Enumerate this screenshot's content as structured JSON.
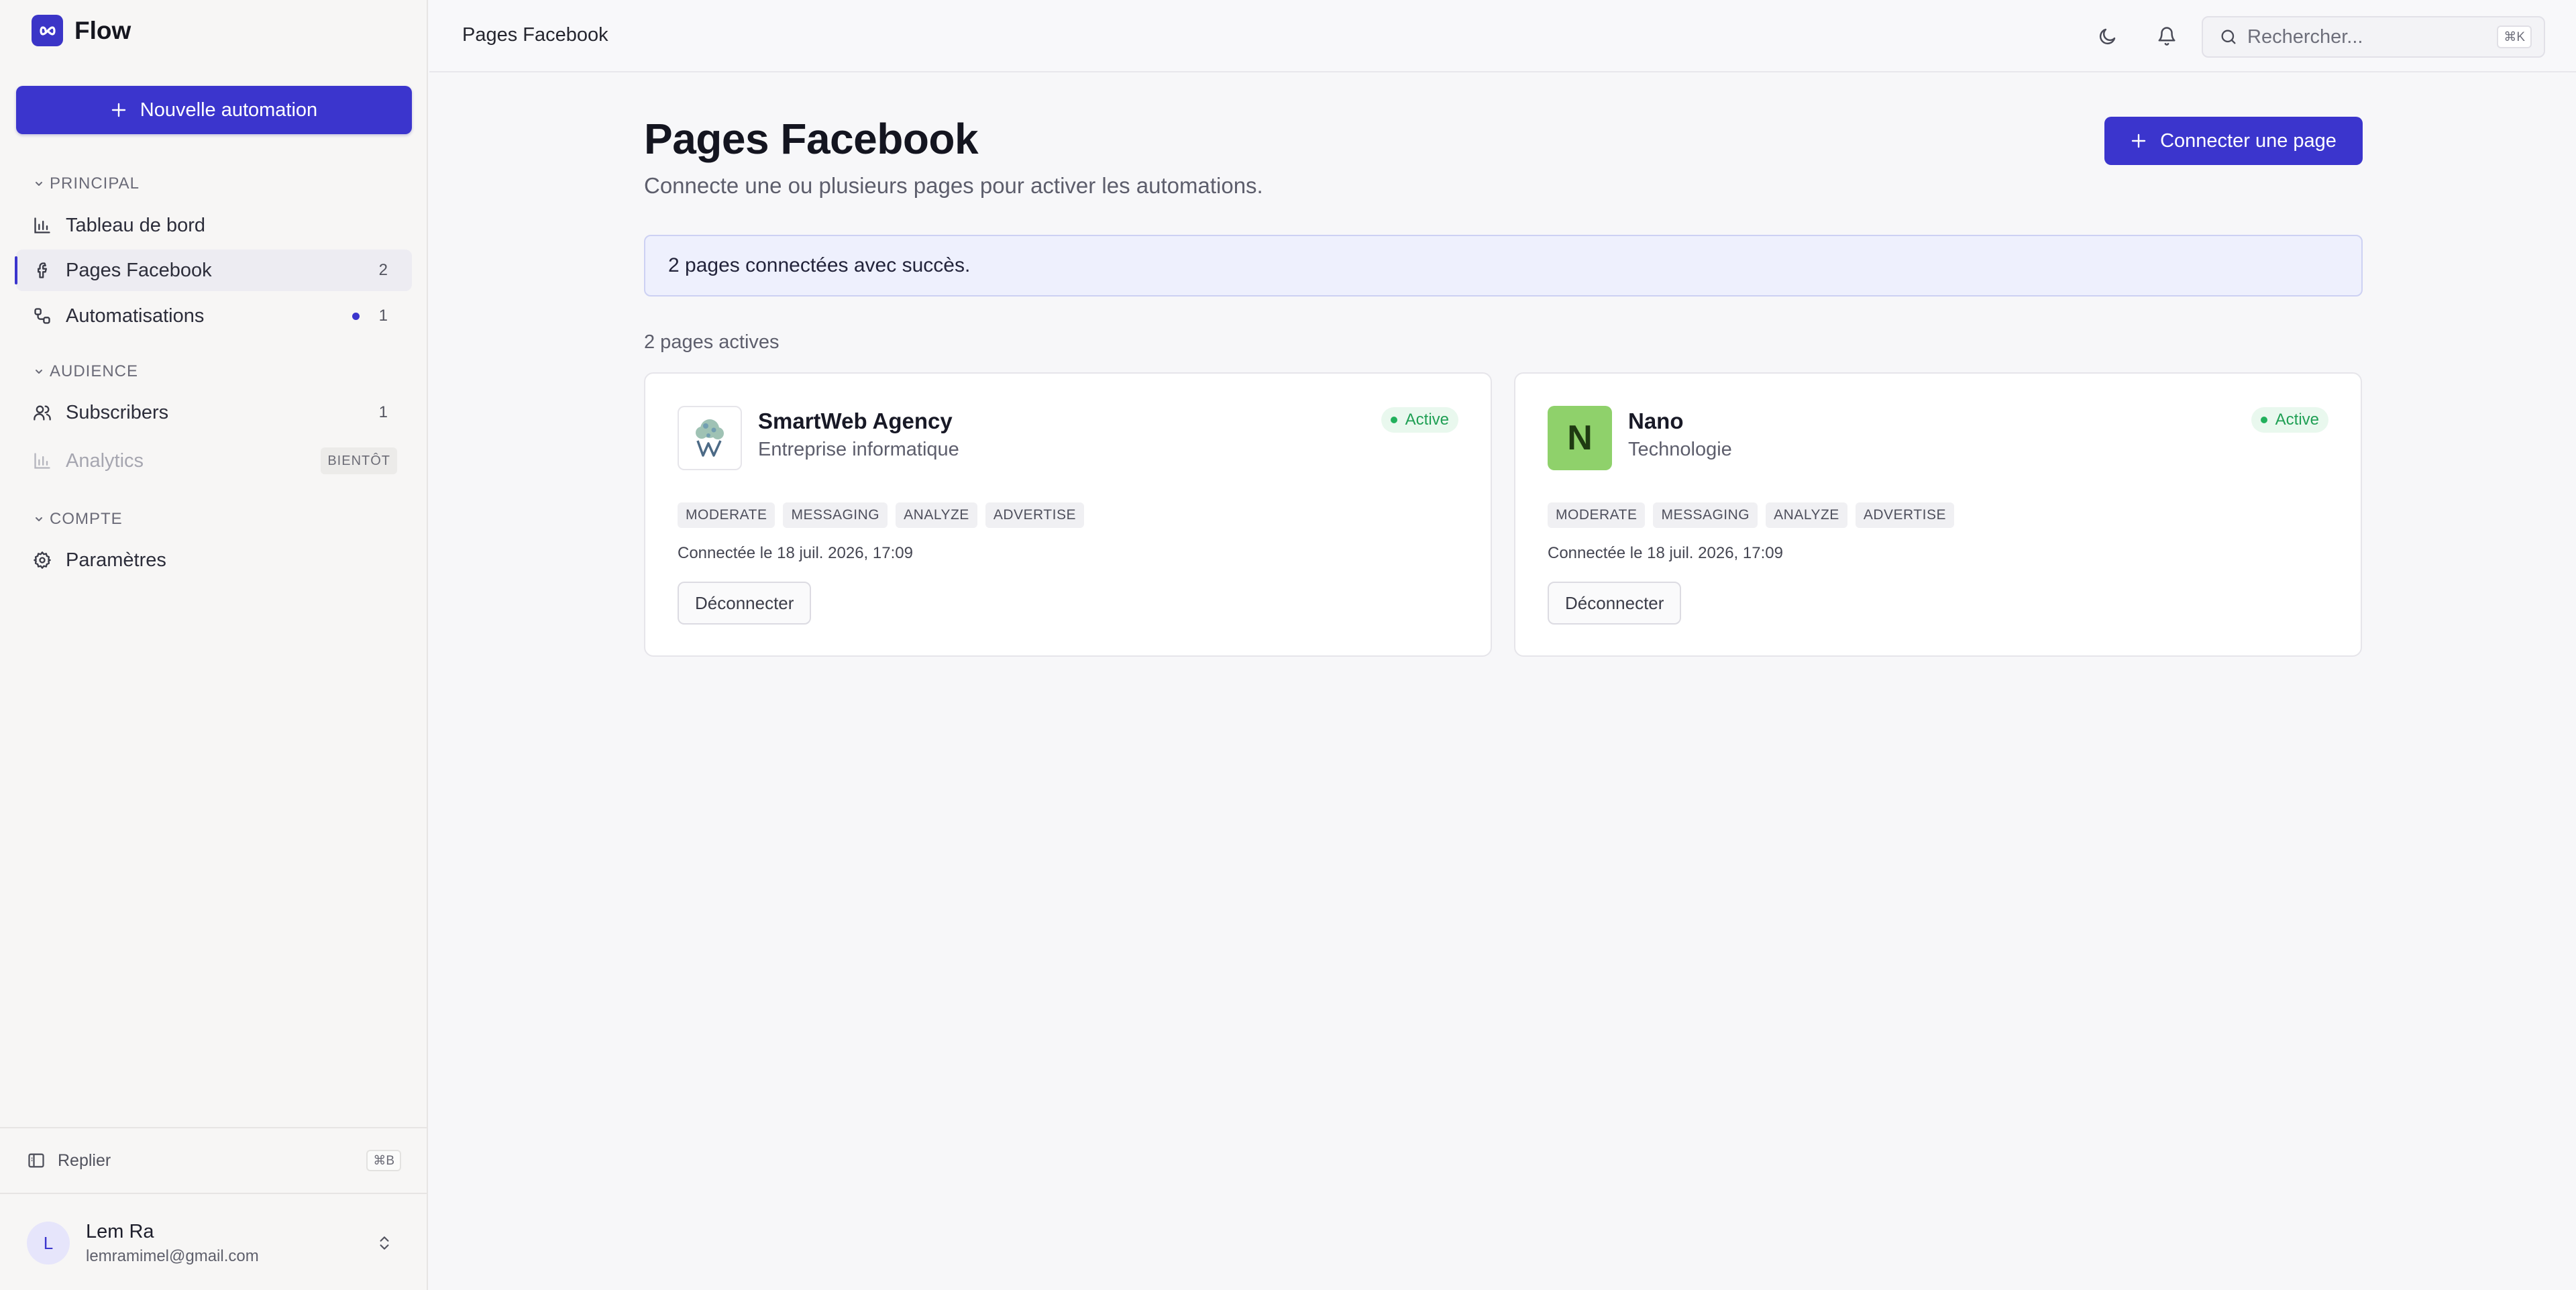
{
  "app": {
    "name": "Flow"
  },
  "sidebar": {
    "new_automation_label": "Nouvelle automation",
    "sections": {
      "principal": "PRINCIPAL",
      "audience": "AUDIENCE",
      "compte": "COMPTE"
    },
    "items": [
      {
        "label": "Tableau de bord",
        "icon": "bar-chart-icon"
      },
      {
        "label": "Pages Facebook",
        "icon": "facebook-icon",
        "count": "2",
        "active": true
      },
      {
        "label": "Automatisations",
        "icon": "workflow-icon",
        "count": "1",
        "has_dot": true
      },
      {
        "label": "Subscribers",
        "icon": "users-icon",
        "count": "1"
      },
      {
        "label": "Analytics",
        "icon": "bar-chart-icon",
        "badge": "BIENTÔT",
        "disabled": true
      },
      {
        "label": "Paramètres",
        "icon": "gear-icon"
      }
    ],
    "collapse": {
      "label": "Replier",
      "shortcut": "⌘B"
    },
    "user": {
      "initial": "L",
      "name": "Lem Ra",
      "email": "lemramimel@gmail.com"
    }
  },
  "topbar": {
    "breadcrumb": "Pages Facebook",
    "search": {
      "placeholder": "Rechercher...",
      "value": "",
      "shortcut": "⌘K"
    }
  },
  "main": {
    "title": "Pages Facebook",
    "subtitle": "Connecte une ou plusieurs pages pour activer les automations.",
    "connect_button": "Connecter une page",
    "success_message": "2 pages connectées avec succès.",
    "active_count_label": "2 pages actives",
    "pages": [
      {
        "name": "SmartWeb Agency",
        "category": "Entreprise informatique",
        "status": "Active",
        "logo_type": "image",
        "permissions": [
          "MODERATE",
          "MESSAGING",
          "ANALYZE",
          "ADVERTISE"
        ],
        "connected_at": "Connectée le 18 juil. 2026, 17:09",
        "disconnect_label": "Déconnecter"
      },
      {
        "name": "Nano",
        "category": "Technologie",
        "status": "Active",
        "logo_type": "letter",
        "logo_letter": "N",
        "permissions": [
          "MODERATE",
          "MESSAGING",
          "ANALYZE",
          "ADVERTISE"
        ],
        "connected_at": "Connectée le 18 juil. 2026, 17:09",
        "disconnect_label": "Déconnecter"
      }
    ]
  },
  "colors": {
    "accent": "#3b35cd",
    "success": "#1f9f54",
    "nano_logo_bg": "#8fd16b"
  }
}
